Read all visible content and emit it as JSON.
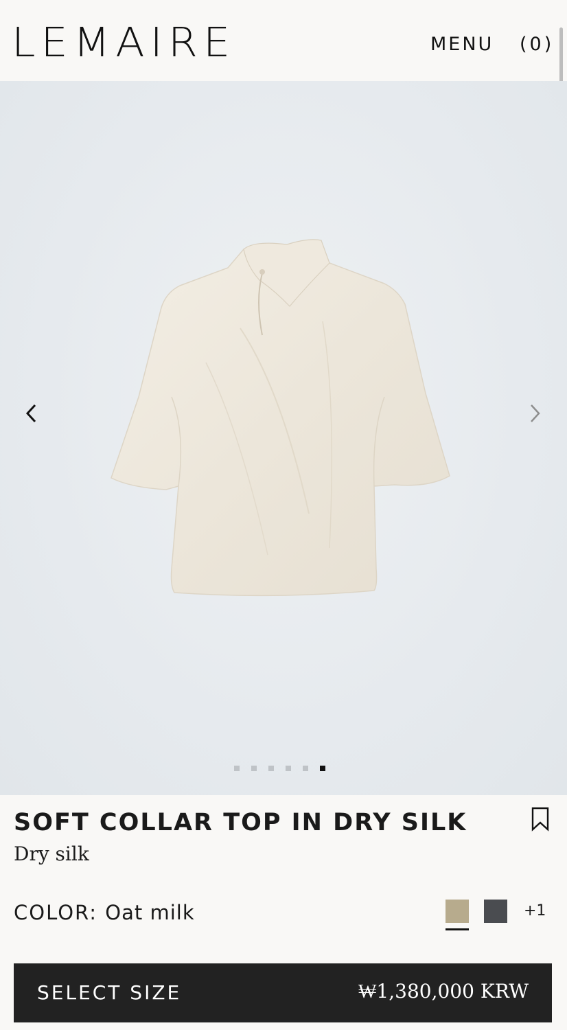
{
  "header": {
    "brand": "LEMAIRE",
    "menu_label": "MENU",
    "cart_label": "(0)"
  },
  "gallery": {
    "product_image_alt": "Soft collar top in oat milk",
    "prev_icon": "chevron-left-icon",
    "next_icon": "chevron-right-icon",
    "slide_count": 6,
    "active_slide": 6
  },
  "product": {
    "title": "SOFT COLLAR TOP IN DRY SILK",
    "material": "Dry silk",
    "bookmark_icon": "bookmark-icon"
  },
  "color": {
    "label": "COLOR:",
    "value": "Oat milk",
    "swatches": [
      "#b7ab8d",
      "#4a4c50"
    ],
    "more": "+1"
  },
  "cta": {
    "label": "SELECT SIZE",
    "price": "₩1,380,000 KRW"
  }
}
